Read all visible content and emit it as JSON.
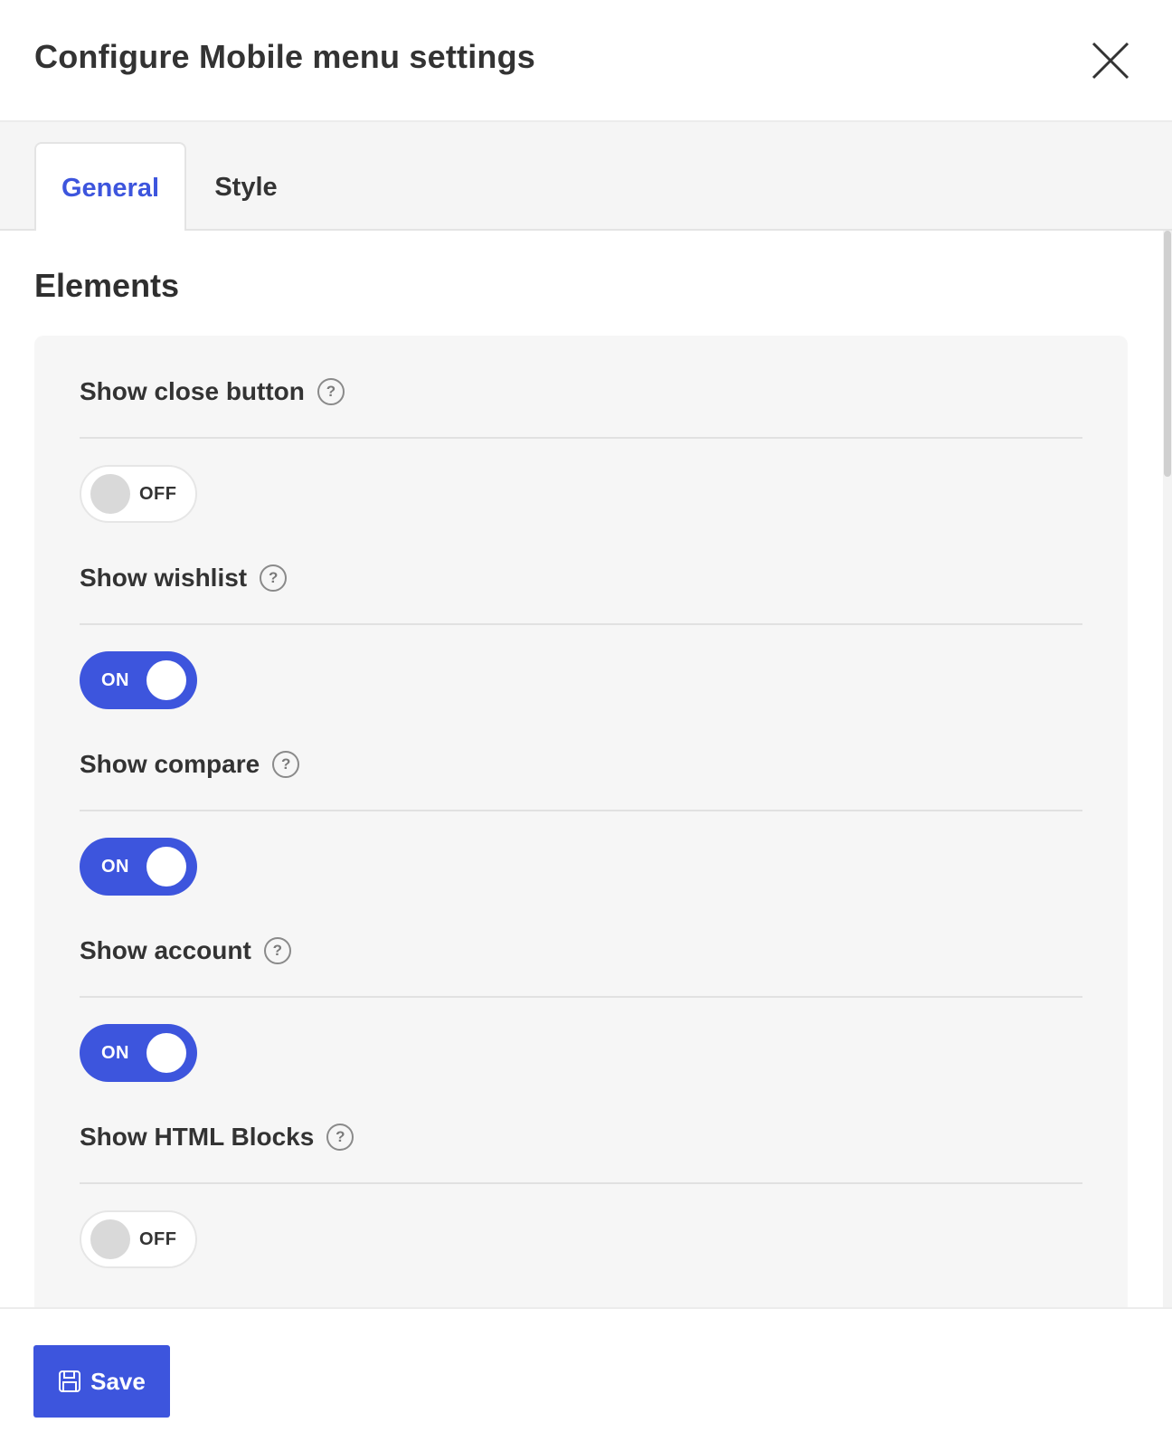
{
  "header": {
    "title": "Configure Mobile menu settings"
  },
  "tabs": [
    {
      "label": "General",
      "active": true
    },
    {
      "label": "Style",
      "active": false
    }
  ],
  "section": {
    "title": "Elements"
  },
  "settings": [
    {
      "label": "Show close button",
      "state": "OFF",
      "on": false,
      "help": "?"
    },
    {
      "label": "Show wishlist",
      "state": "ON",
      "on": true,
      "help": "?"
    },
    {
      "label": "Show compare",
      "state": "ON",
      "on": true,
      "help": "?"
    },
    {
      "label": "Show account",
      "state": "ON",
      "on": true,
      "help": "?"
    },
    {
      "label": "Show HTML Blocks",
      "state": "OFF",
      "on": false,
      "help": "?"
    }
  ],
  "footer": {
    "save_label": "Save"
  },
  "colors": {
    "accent": "#3d55dd",
    "panel": "#f6f6f6",
    "tabs_bg": "#f5f5f5"
  },
  "icons": {
    "close": "close-icon",
    "help": "help-icon",
    "save": "floppy-disk-icon"
  }
}
